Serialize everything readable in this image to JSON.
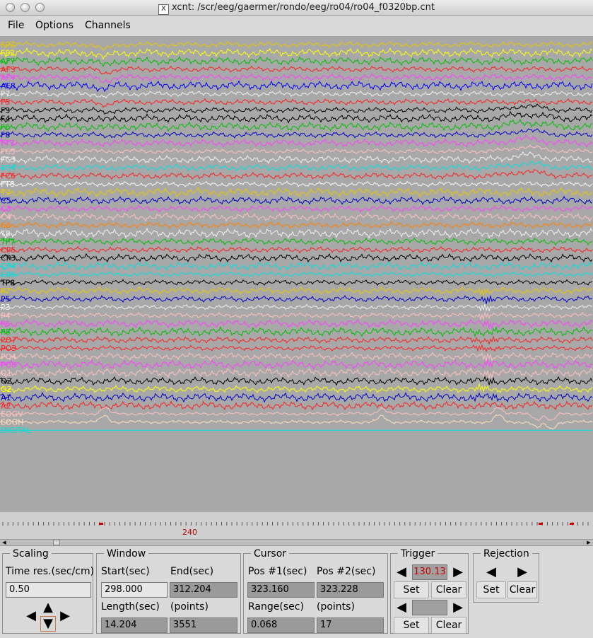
{
  "window": {
    "title": "xcnt: /scr/eeg/gaermer/rondo/eeg/ro04/ro04_f0320bp.cnt",
    "x_glyph": "X"
  },
  "menu": {
    "file": "File",
    "options": "Options",
    "channels": "Channels"
  },
  "channels": [
    {
      "name": "FPZ",
      "color": "#e6c800"
    },
    {
      "name": "FP2",
      "color": "#ffff00"
    },
    {
      "name": "AF7",
      "color": "#00c000"
    },
    {
      "name": "AF3",
      "color": "#ff2020"
    },
    {
      "name": "AF4",
      "color": "#ff40ff"
    },
    {
      "name": "AF8",
      "color": "#0000ff"
    },
    {
      "name": "F7",
      "color": "#f0f0f0"
    },
    {
      "name": "F5",
      "color": "#ff2020"
    },
    {
      "name": "F3",
      "color": "#000000"
    },
    {
      "name": "F4",
      "color": "#000000"
    },
    {
      "name": "F6",
      "color": "#00c000"
    },
    {
      "name": "F8",
      "color": "#0000cc"
    },
    {
      "name": "FT7",
      "color": "#ff40ff"
    },
    {
      "name": "FC5",
      "color": "#ffc0c0"
    },
    {
      "name": "FC3",
      "color": "#f0f0f0"
    },
    {
      "name": "FC4",
      "color": "#00e0e0"
    },
    {
      "name": "FC6",
      "color": "#ff2020"
    },
    {
      "name": "FT8",
      "color": "#f8f8f8"
    },
    {
      "name": "T7",
      "color": "#e6c800"
    },
    {
      "name": "C5",
      "color": "#0000cc"
    },
    {
      "name": "C3",
      "color": "#ff40ff"
    },
    {
      "name": "C4",
      "color": "#ffc0c0"
    },
    {
      "name": "C6",
      "color": "#ff8000"
    },
    {
      "name": "T8",
      "color": "#f0f0f0"
    },
    {
      "name": "TP7",
      "color": "#00c000"
    },
    {
      "name": "CP5",
      "color": "#ff2020"
    },
    {
      "name": "CP3",
      "color": "#000000"
    },
    {
      "name": "CP4",
      "color": "#00e0e0"
    },
    {
      "name": "CP6",
      "color": "#00e0e0"
    },
    {
      "name": "TP8",
      "color": "#000000"
    },
    {
      "name": "P7",
      "color": "#e6c800"
    },
    {
      "name": "P5",
      "color": "#0000cc"
    },
    {
      "name": "P3",
      "color": "#f0f0f0"
    },
    {
      "name": "P4",
      "color": "#ffc0c0"
    },
    {
      "name": "P6",
      "color": "#ff40ff"
    },
    {
      "name": "P8",
      "color": "#00c000"
    },
    {
      "name": "PO7",
      "color": "#ff2020"
    },
    {
      "name": "PO3",
      "color": "#ff2020"
    },
    {
      "name": "PO4",
      "color": "#ffc0c0"
    },
    {
      "name": "PO8",
      "color": "#ff40ff"
    },
    {
      "name": "O1",
      "color": "#ffc0c0"
    },
    {
      "name": "OZ",
      "color": "#000000"
    },
    {
      "name": "O2",
      "color": "#ffff00"
    },
    {
      "name": "A1",
      "color": "#0000cc"
    },
    {
      "name": "A2",
      "color": "#ff2020"
    },
    {
      "name": "EOGV",
      "color": "#ffc0c0"
    },
    {
      "name": "EOGH",
      "color": "#ffe0c0"
    },
    {
      "name": "DIGITAL",
      "color": "#00e0e0"
    }
  ],
  "ruler": {
    "label": "240"
  },
  "scaling": {
    "title": "Scaling",
    "time_res_label": "Time res.(sec/cm)",
    "time_res_value": "0.50"
  },
  "window_group": {
    "title": "Window",
    "start_label": "Start(sec)",
    "end_label": "End(sec)",
    "start_value": "298.000",
    "end_value": "312.204",
    "length_label": "Length(sec)",
    "points_label": "(points)",
    "length_value": "14.204",
    "points_value": "3551"
  },
  "cursor": {
    "title": "Cursor",
    "pos1_label": "Pos #1(sec)",
    "pos2_label": "Pos #2(sec)",
    "pos1_value": "323.160",
    "pos2_value": "323.228",
    "range_label": "Range(sec)",
    "points_label": "(points)",
    "range_value": "0.068",
    "points_value": "17"
  },
  "trigger": {
    "title": "Trigger",
    "value": "130.13",
    "value_color": "#cc0000",
    "set": "Set",
    "clear": "Clear",
    "set2": "Set",
    "clear2": "Clear"
  },
  "rejection": {
    "title": "Rejection",
    "set": "Set",
    "clear": "Clear"
  }
}
